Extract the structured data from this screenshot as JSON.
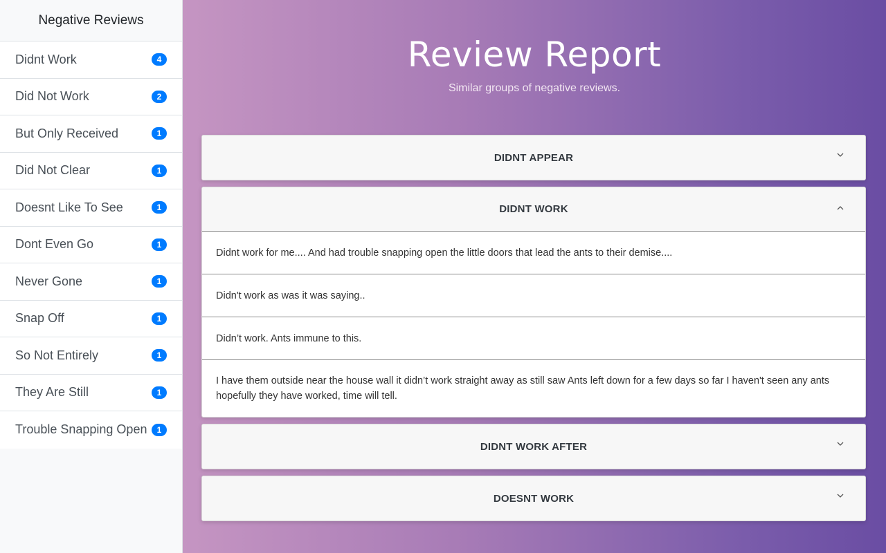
{
  "sidebar": {
    "header": "Negative Reviews",
    "items": [
      {
        "label": "Didnt Work",
        "count": "4"
      },
      {
        "label": "Did Not Work",
        "count": "2"
      },
      {
        "label": "But Only Received",
        "count": "1"
      },
      {
        "label": "Did Not Clear",
        "count": "1"
      },
      {
        "label": "Doesnt Like To See",
        "count": "1"
      },
      {
        "label": "Dont Even Go",
        "count": "1"
      },
      {
        "label": "Never Gone",
        "count": "1"
      },
      {
        "label": "Snap Off",
        "count": "1"
      },
      {
        "label": "So Not Entirely",
        "count": "1"
      },
      {
        "label": "They Are Still",
        "count": "1"
      },
      {
        "label": "Trouble Snapping Open",
        "count": "1"
      }
    ]
  },
  "main": {
    "title": "Review Report",
    "subtitle": "Similar groups of negative reviews.",
    "groups": [
      {
        "title": "DIDNT APPEAR",
        "expanded": false,
        "reviews": []
      },
      {
        "title": "DIDNT WORK",
        "expanded": true,
        "reviews": [
          "Didnt work for me.... And had trouble snapping open the little doors that lead the ants to their demise....",
          "Didn't work as was it was saying..",
          "Didn’t work. Ants immune to this.",
          "I have them outside near the house wall it didn’t work straight away as still saw Ants left down for a few days so far I haven't seen any ants hopefully they have worked, time will tell."
        ]
      },
      {
        "title": "DIDNT WORK AFTER",
        "expanded": false,
        "reviews": []
      },
      {
        "title": "DOESNT WORK",
        "expanded": false,
        "reviews": []
      }
    ]
  },
  "icons": {
    "expand": "chevron-down-icon",
    "collapse": "chevron-up-icon"
  },
  "colors": {
    "badge": "#007bff",
    "gradient_start": "#c595c2",
    "gradient_end": "#6a4da3"
  }
}
